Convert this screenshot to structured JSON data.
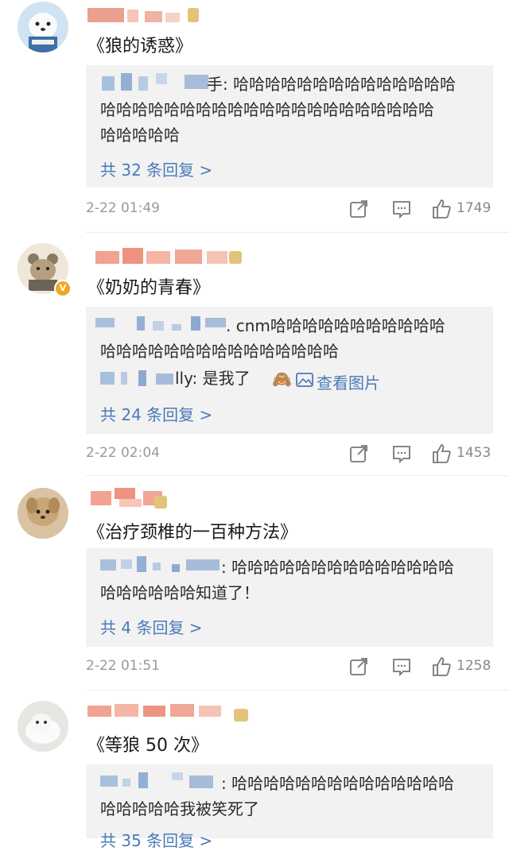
{
  "comments": [
    {
      "title": "《狼的诱惑》",
      "reply_lines": [
        "手: 哈哈哈哈哈哈哈哈哈哈哈哈哈哈",
        "哈哈哈哈哈哈哈哈哈哈哈哈哈哈哈哈哈哈哈哈哈",
        "哈哈哈哈哈"
      ],
      "more": "共 32 条回复 >",
      "time": "2-22 01:49",
      "likes": "1749"
    },
    {
      "title": "《奶奶的青春》",
      "reply_lines": [
        ". cnm哈哈哈哈哈哈哈哈哈哈哈",
        "哈哈哈哈哈哈哈哈哈哈哈哈哈哈哈"
      ],
      "sub_reply": "lly: 是我了",
      "sub_reply_link": "查看图片",
      "more": "共 24 条回复 >",
      "time": "2-22 02:04",
      "likes": "1453"
    },
    {
      "title": "《治疗颈椎的一百种方法》",
      "reply_lines": [
        ": 哈哈哈哈哈哈哈哈哈哈哈哈哈哈",
        "哈哈哈哈哈哈知道了！"
      ],
      "more": "共 4 条回复 >",
      "time": "2-22 01:51",
      "likes": "1258"
    },
    {
      "title": "《等狼 50 次》",
      "reply_lines": [
        ": 哈哈哈哈哈哈哈哈哈哈哈哈哈哈",
        "哈哈哈哈哈我被笑死了"
      ],
      "more": "共 35 条回复 >"
    }
  ],
  "icons": {
    "share": "share-icon",
    "comment": "comment-icon",
    "like": "thumbs-up-icon",
    "verified": "verified-badge-icon",
    "emoji": "monkey-emoji-icon",
    "image": "image-icon"
  },
  "colors": {
    "link": "#4a7ab7",
    "reply_bg": "#f2f2f2",
    "meta": "#999999"
  }
}
